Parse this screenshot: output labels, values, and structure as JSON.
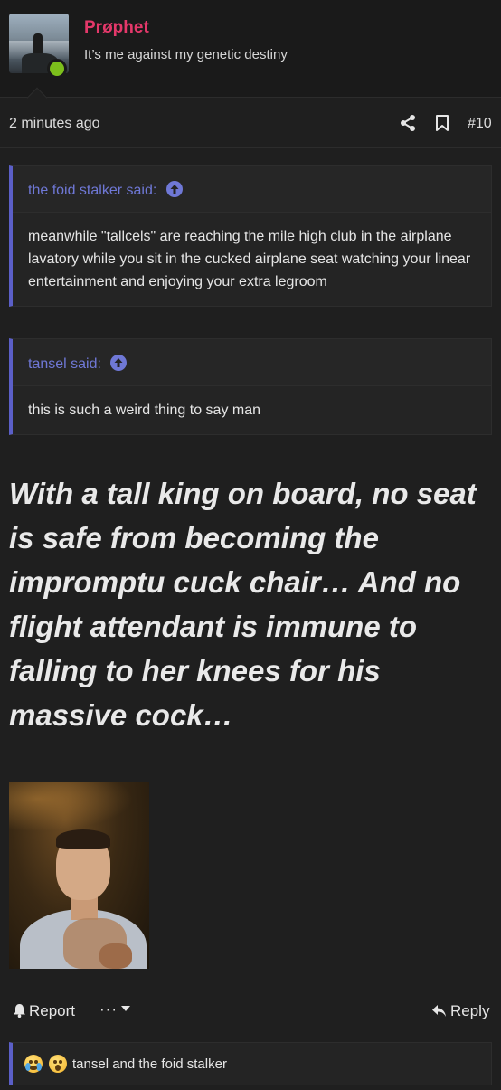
{
  "post": {
    "username": "Prøphet",
    "user_title": "It’s me against my genetic destiny",
    "timestamp": "2 minutes ago",
    "post_number": "#10",
    "quotes": [
      {
        "author": "the foid stalker said:",
        "text": "meanwhile \"tallcels\" are reaching the mile high club in the airplane lavatory while you sit in the cucked airplane seat watching your linear entertainment and enjoying your extra legroom"
      },
      {
        "author": "tansel said:",
        "text": "this is such a weird thing to say man"
      }
    ],
    "body_text": "With a tall king on board, no seat is safe from becoming the impromptu cuck chair… And no flight attendant is immune to falling to her knees for his massive cock…"
  },
  "actions": {
    "report_label": "Report",
    "more_label": "···",
    "reply_label": "Reply"
  },
  "reactions": {
    "emojis": [
      "crying-face-emoji",
      "astonished-face-emoji"
    ],
    "text": "tansel and the foid stalker"
  },
  "colors": {
    "username": "#e4386a",
    "quote_accent": "#5b5fc7",
    "quote_author": "#6f78d6",
    "online": "#7cbf1c",
    "background": "#1f1f1f"
  }
}
